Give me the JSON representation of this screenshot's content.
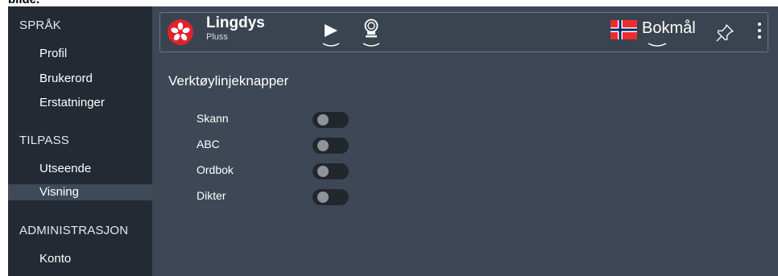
{
  "page": {
    "cropped_top_text": "bilde."
  },
  "sidebar": {
    "sections": [
      {
        "header": "SPRÅK",
        "items": [
          {
            "label": "Profil"
          },
          {
            "label": "Brukerord"
          },
          {
            "label": "Erstatninger"
          }
        ]
      },
      {
        "header": "TILPASS",
        "items": [
          {
            "label": "Utseende"
          },
          {
            "label": "Visning",
            "active": true
          }
        ]
      },
      {
        "header": "ADMINISTRASJON",
        "items": [
          {
            "label": "Konto"
          }
        ]
      }
    ]
  },
  "toolbar": {
    "logo_icon": "flower-icon",
    "brand_name": "Lingdys",
    "brand_sub": "Pluss",
    "buttons": [
      {
        "icon": "play-icon",
        "menu_icon": "chevron-down-icon"
      },
      {
        "icon": "microphone-icon",
        "menu_icon": "chevron-down-icon"
      }
    ],
    "language": {
      "flag_icon": "norway-flag-icon",
      "label": "Bokmål"
    },
    "pin_icon": "pin-icon",
    "more_icon": "more-vertical-icon"
  },
  "main": {
    "section_title": "Verktøylinjeknapper",
    "toggles": [
      {
        "label": "Skann",
        "on": false
      },
      {
        "label": "ABC",
        "on": false
      },
      {
        "label": "Ordbok",
        "on": false
      },
      {
        "label": "Dikter",
        "on": false
      }
    ]
  },
  "colors": {
    "sidebar_bg": "#232a33",
    "main_bg": "#3e4756",
    "active_item_bg": "#3f4a58",
    "logo_red": "#e0222b",
    "toggle_track": "#22262d",
    "toggle_knob": "#8e939a"
  }
}
